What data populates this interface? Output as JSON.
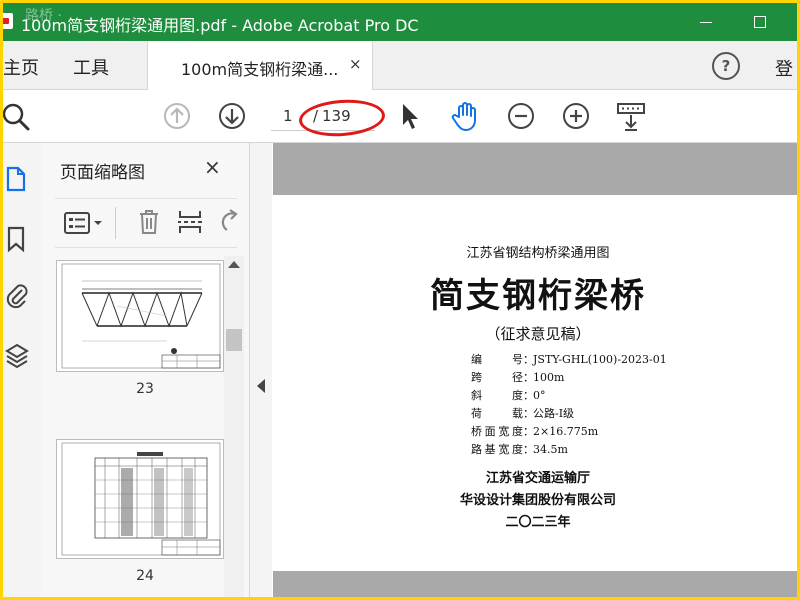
{
  "window": {
    "title": "100m简支钢桁梁通用图.pdf - Adobe Acrobat Pro DC",
    "watermark": "路桥 ·"
  },
  "tabs": {
    "home": "主页",
    "tools": "工具",
    "document_tab": "100m简支钢桁梁通...",
    "close_glyph": "×",
    "help_glyph": "?",
    "login": "登"
  },
  "toolbar": {
    "current_page": "1",
    "separator": "/",
    "total_pages": "139"
  },
  "thumbnails_panel": {
    "title": "页面缩略图",
    "close_glyph": "×",
    "pages": [
      {
        "label": "23"
      },
      {
        "label": "24"
      }
    ]
  },
  "document": {
    "subtitle": "江苏省钢结构桥梁通用图",
    "main_title": "简支钢桁梁桥",
    "note": "（征求意见稿）",
    "specs": [
      {
        "key": "编号",
        "value": "JSTY-GHL(100)-2023-01"
      },
      {
        "key": "跨径",
        "value": "100m"
      },
      {
        "key": "斜度",
        "value": "0°"
      },
      {
        "key": "荷载",
        "value": "公路-I级"
      },
      {
        "key": "桥面宽度",
        "value": "2×16.775m"
      },
      {
        "key": "路基宽度",
        "value": "34.5m"
      }
    ],
    "colon": "：",
    "org1": "江苏省交通运输厅",
    "org2": "华设设计集团股份有限公司",
    "year": "二〇二三年"
  },
  "colors": {
    "titlebar": "#1e8e3e",
    "frame": "#ffd400",
    "annotation_ring": "#e01818",
    "accent_blue": "#1473e6"
  }
}
